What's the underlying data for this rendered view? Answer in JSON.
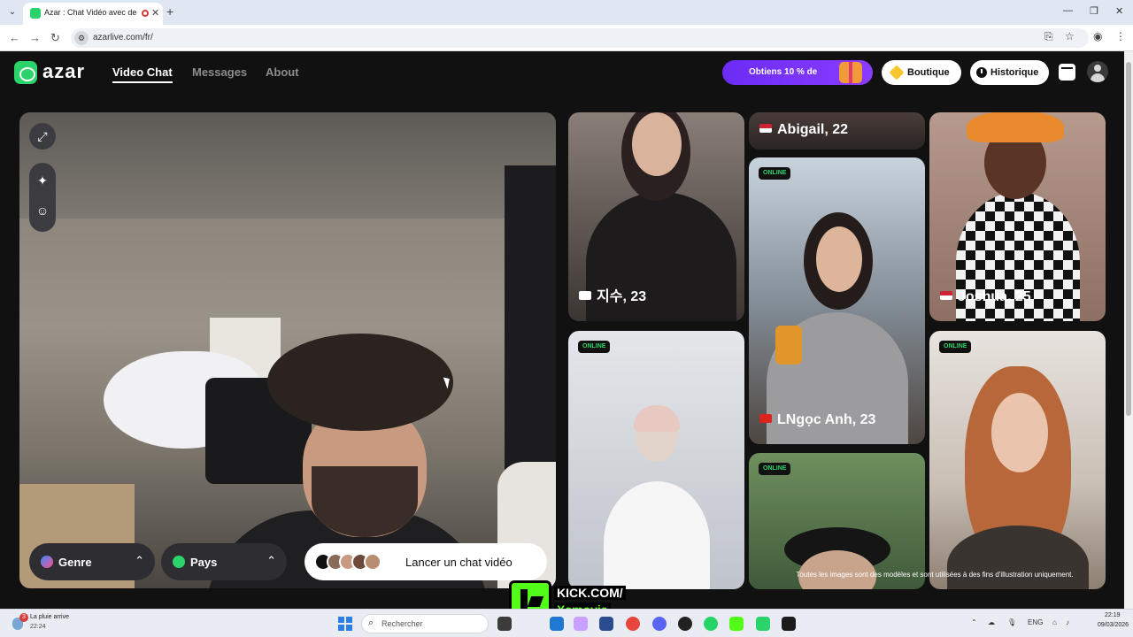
{
  "browser": {
    "tab_title": "Azar : Chat Vidéo avec de n",
    "new_tab_symbol": "+",
    "close_symbol": "✕",
    "url": "azarlive.com/fr/"
  },
  "site": {
    "logo_text": "azar",
    "nav": [
      {
        "label": "Video Chat",
        "active": true
      },
      {
        "label": "Messages",
        "active": false
      },
      {
        "label": "About",
        "active": false
      }
    ],
    "promo_label": "Obtiens 10 % de",
    "shop_label": "Boutique",
    "history_label": "Historique",
    "accent_color": "#2bd36b",
    "promo_color": "#7b35f7"
  },
  "controls": {
    "gender_label": "Genre",
    "country_label": "Pays",
    "start_label": "Lancer un chat vidéo"
  },
  "cards": {
    "online_label": "ONLINE",
    "jisu": "지수, 23",
    "abigail": "Abigail, 22",
    "joshua": "Joshua, 25",
    "ngoc_anh": "LNgọc Anh, 23"
  },
  "disclaimer": "Toutes les images sont des modèles et sont utilisées à des fins d'illustration uniquement.",
  "overlay": {
    "kick_line1": "KICK.COM/",
    "kick_line2": "Xamovie"
  },
  "taskbar": {
    "weather_title": "La pluie arrive",
    "weather_time": "22:24",
    "weather_badge": "3",
    "search_placeholder": "Rechercher",
    "language": "ENG",
    "time": "22:19",
    "date": "09/03/2026"
  }
}
